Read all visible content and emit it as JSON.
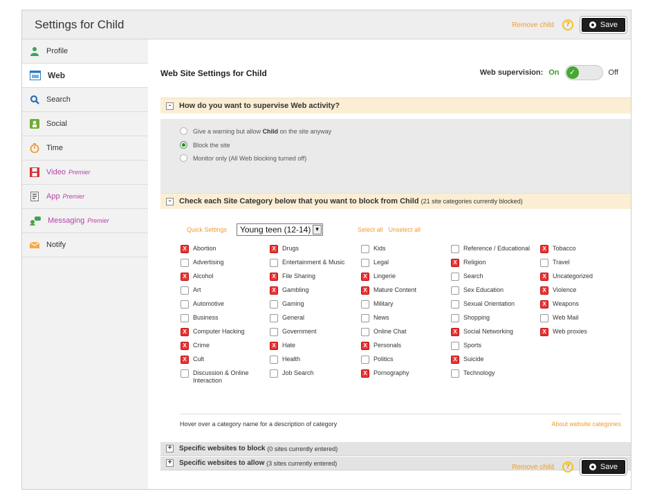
{
  "header": {
    "title": "Settings for Child",
    "remove_child": "Remove child",
    "help": "?",
    "save": "Save"
  },
  "sidebar": {
    "items": [
      {
        "label": "Profile",
        "premier": "",
        "icon": "person-icon"
      },
      {
        "label": "Web",
        "premier": "",
        "icon": "web-icon"
      },
      {
        "label": "Search",
        "premier": "",
        "icon": "search-icon"
      },
      {
        "label": "Social",
        "premier": "",
        "icon": "social-icon"
      },
      {
        "label": "Time",
        "premier": "",
        "icon": "clock-icon"
      },
      {
        "label": "Video",
        "premier": "Premier",
        "icon": "video-icon"
      },
      {
        "label": "App",
        "premier": "Premier",
        "icon": "app-icon"
      },
      {
        "label": "Messaging",
        "premier": "Premier",
        "icon": "messaging-icon"
      },
      {
        "label": "Notify",
        "premier": "",
        "icon": "mail-icon"
      }
    ],
    "active": "Web"
  },
  "main": {
    "title": "Web Site Settings for Child",
    "supervision_label": "Web supervision:",
    "on": "On",
    "off": "Off",
    "check_mark": "✓"
  },
  "supervise": {
    "heading": "How do you want to supervise Web activity?",
    "collapse": "-",
    "options": [
      {
        "pre": "Give a warning but allow ",
        "bold": "Child",
        "post": " on the site anyway",
        "selected": false
      },
      {
        "pre": "Block the site",
        "bold": "",
        "post": "",
        "selected": true
      },
      {
        "pre": "Monitor only (All Web blocking turned off)",
        "bold": "",
        "post": "",
        "selected": false
      }
    ]
  },
  "categories": {
    "heading_pre": "Check each Site Category below that you want to block from ",
    "heading_bold": "Child",
    "heading_note": "(21 site categories currently blocked)",
    "collapse": "-",
    "quick_label": "Quick Settings",
    "quick_value": "Young teen (12-14)",
    "select_all": "Select all",
    "unselect_all": "Unselect all",
    "checked_mark": "X",
    "columns": [
      [
        {
          "name": "Abortion",
          "checked": true
        },
        {
          "name": "Advertising",
          "checked": false
        },
        {
          "name": "Alcohol",
          "checked": true
        },
        {
          "name": "Art",
          "checked": false
        },
        {
          "name": "Automotive",
          "checked": false
        },
        {
          "name": "Business",
          "checked": false
        },
        {
          "name": "Computer Hacking",
          "checked": true
        },
        {
          "name": "Crime",
          "checked": true
        },
        {
          "name": "Cult",
          "checked": true
        },
        {
          "name": "Discussion & Online Interaction",
          "checked": false
        }
      ],
      [
        {
          "name": "Drugs",
          "checked": true
        },
        {
          "name": "Entertainment & Music",
          "checked": false
        },
        {
          "name": "File Sharing",
          "checked": true
        },
        {
          "name": "Gambling",
          "checked": true
        },
        {
          "name": "Gaming",
          "checked": false
        },
        {
          "name": "General",
          "checked": false
        },
        {
          "name": "Government",
          "checked": false
        },
        {
          "name": "Hate",
          "checked": true
        },
        {
          "name": "Health",
          "checked": false
        },
        {
          "name": "Job Search",
          "checked": false
        }
      ],
      [
        {
          "name": "Kids",
          "checked": false
        },
        {
          "name": "Legal",
          "checked": false
        },
        {
          "name": "Lingerie",
          "checked": true
        },
        {
          "name": "Mature Content",
          "checked": true
        },
        {
          "name": "Military",
          "checked": false
        },
        {
          "name": "News",
          "checked": false
        },
        {
          "name": "Online Chat",
          "checked": false
        },
        {
          "name": "Personals",
          "checked": true
        },
        {
          "name": "Politics",
          "checked": false
        },
        {
          "name": "Pornography",
          "checked": true
        }
      ],
      [
        {
          "name": "Reference / Educational",
          "checked": false
        },
        {
          "name": "Religion",
          "checked": true
        },
        {
          "name": "Search",
          "checked": false
        },
        {
          "name": "Sex Education",
          "checked": false
        },
        {
          "name": "Sexual Orientation",
          "checked": false
        },
        {
          "name": "Shopping",
          "checked": false
        },
        {
          "name": "Social Networking",
          "checked": true
        },
        {
          "name": "Sports",
          "checked": false
        },
        {
          "name": "Suicide",
          "checked": true
        },
        {
          "name": "Technology",
          "checked": false
        }
      ],
      [
        {
          "name": "Tobacco",
          "checked": true
        },
        {
          "name": "Travel",
          "checked": false
        },
        {
          "name": "Uncategorized",
          "checked": true
        },
        {
          "name": "Violence",
          "checked": true
        },
        {
          "name": "Weapons",
          "checked": true
        },
        {
          "name": "Web Mail",
          "checked": false
        },
        {
          "name": "Web proxies",
          "checked": true
        }
      ]
    ],
    "hover_note": "Hover over a category name for a description of category",
    "about_link": "About website categories"
  },
  "specific_block": {
    "expand": "+",
    "label": "Specific websites to block",
    "note": "(0 sites currently entered)"
  },
  "specific_allow": {
    "expand": "+",
    "label": "Specific websites to allow",
    "note": "(3 sites currently entered)"
  },
  "footer": {
    "remove_child": "Remove child",
    "help": "?",
    "save": "Save"
  },
  "colors": {
    "accent_orange": "#f29a2e",
    "premier_purple": "#b443a8",
    "toggle_green": "#46a832",
    "checked_red": "#e33333"
  }
}
